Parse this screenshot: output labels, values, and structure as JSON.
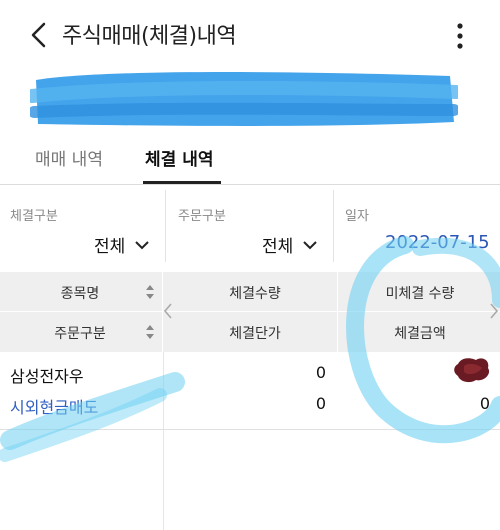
{
  "header": {
    "title": "주식매매(체결)내역"
  },
  "tabs": [
    {
      "label": "매매 내역",
      "active": false
    },
    {
      "label": "체결 내역",
      "active": true
    }
  ],
  "filters": {
    "execution_type": {
      "label": "체결구분",
      "value": "전체"
    },
    "order_type": {
      "label": "주문구분",
      "value": "전체"
    },
    "date": {
      "label": "일자",
      "value": "2022-07-15"
    }
  },
  "table": {
    "left_headers": [
      "종목명",
      "주문구분"
    ],
    "right_headers_row1": [
      "체결수량",
      "미체결 수량"
    ],
    "right_headers_row2": [
      "체결단가",
      "체결금액"
    ],
    "rows": [
      {
        "stock_name": "삼성전자우",
        "order_type": "시외현금매도",
        "exec_qty": "0",
        "unexec_qty": "",
        "exec_price": "0",
        "exec_amount": "0"
      }
    ]
  },
  "colors": {
    "accent": "#2f5fc2",
    "date": "#2a56b5",
    "header_bg": "#efefef",
    "scribble": "#5ec4ea"
  }
}
